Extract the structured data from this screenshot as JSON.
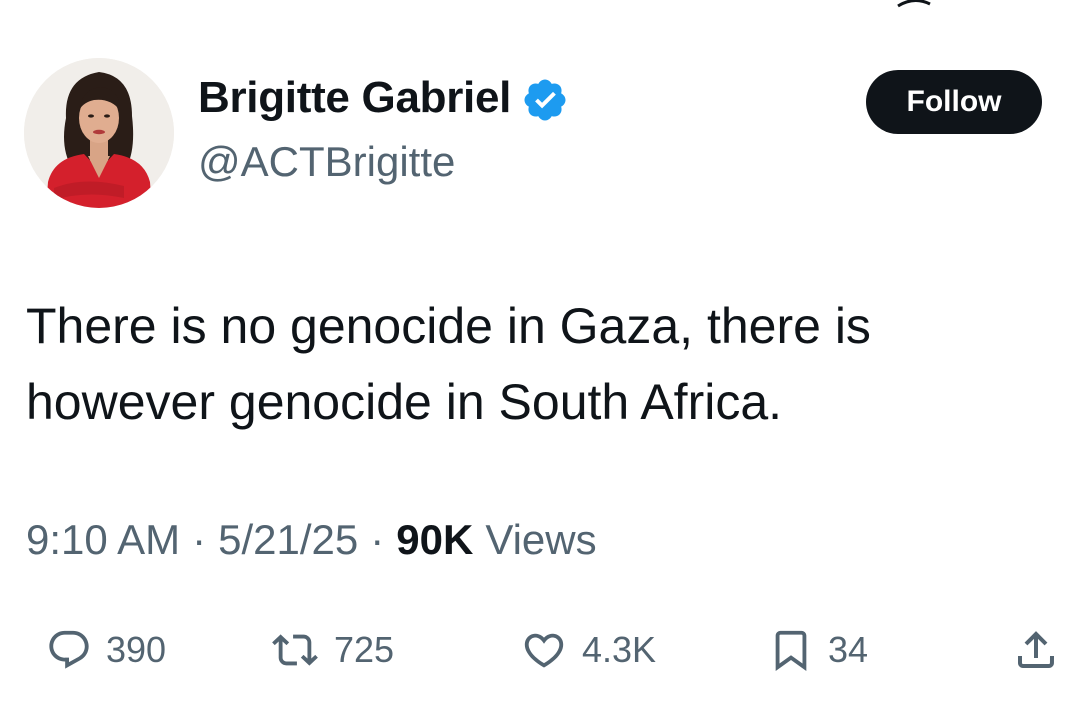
{
  "profile": {
    "display_name": "Brigitte Gabriel",
    "handle": "@ACTBrigitte",
    "verified_icon": "verified-badge-icon",
    "avatar": "profile-photo"
  },
  "follow_button": {
    "label": "Follow"
  },
  "tweet": {
    "text": "There is no genocide in Gaza, there is however genocide in South Africa."
  },
  "meta": {
    "time": "9:10 AM",
    "separator": "·",
    "date": "5/21/25",
    "views_count": "90K",
    "views_label": "Views"
  },
  "actions": {
    "replies": "390",
    "reposts": "725",
    "likes": "4.3K",
    "bookmarks": "34"
  },
  "colors": {
    "text_primary": "#0f1419",
    "text_secondary": "#536471",
    "verified_blue": "#1d9bf0",
    "button_bg": "#0f1419"
  }
}
